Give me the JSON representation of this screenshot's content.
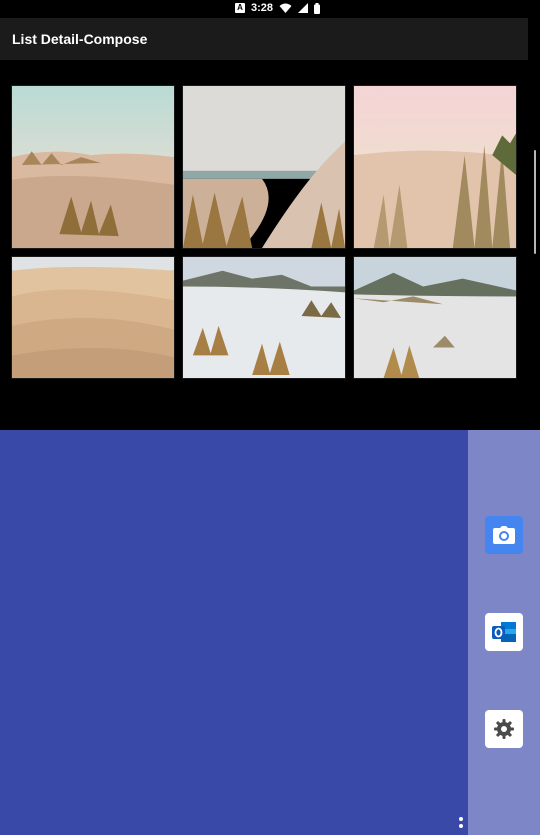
{
  "status_bar": {
    "time": "3:28",
    "notification_badge": "A",
    "icons": [
      "notification-a-icon",
      "wifi-icon",
      "cellular-icon",
      "battery-icon"
    ]
  },
  "app_bar": {
    "title": "List Detail-Compose"
  },
  "gallery": {
    "photos": [
      {
        "name": "dunes-sea-grass-1"
      },
      {
        "name": "dunes-sea-view"
      },
      {
        "name": "dunes-sunset-grass"
      },
      {
        "name": "sand-dunes-desert"
      },
      {
        "name": "white-dunes-mountains-1"
      },
      {
        "name": "white-dunes-mountains-2"
      }
    ]
  },
  "taskbar": {
    "apps": [
      {
        "icon": "camera-icon",
        "label": "Camera"
      },
      {
        "icon": "outlook-icon",
        "label": "Outlook"
      },
      {
        "icon": "settings-gear-icon",
        "label": "Settings"
      }
    ]
  },
  "colors": {
    "detail_pane": "#3949a8",
    "taskbar": "#7d86c6",
    "app_bar": "#1b1b1b",
    "camera_tile": "#4585f0"
  }
}
